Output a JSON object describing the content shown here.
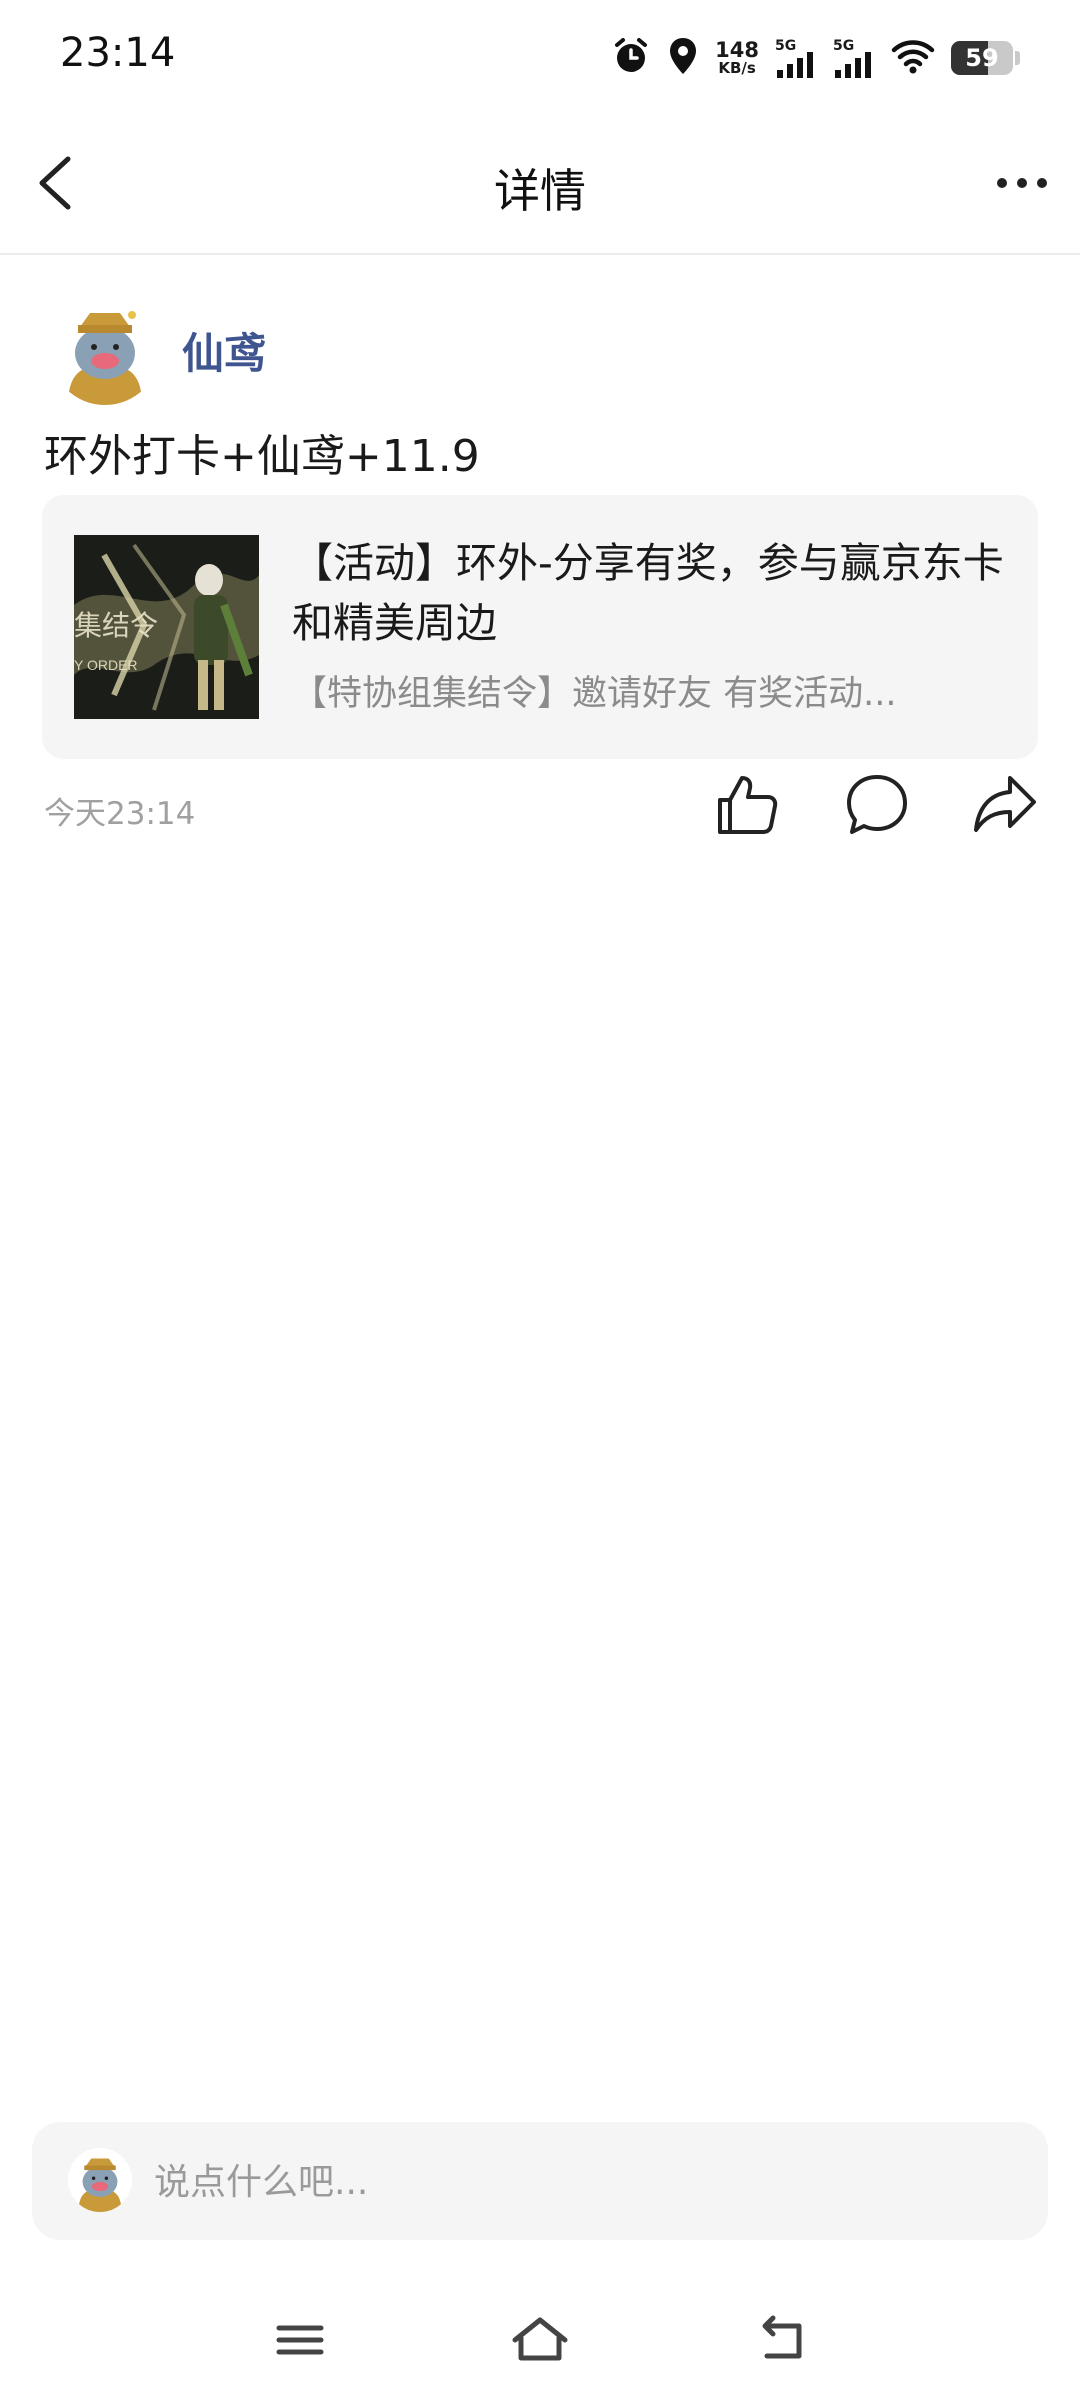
{
  "status_bar": {
    "time": "23:14",
    "net_speed_value": "148",
    "net_speed_unit": "KB/s",
    "signal1_label": "5G",
    "signal2_label": "5G",
    "battery_level": "59",
    "battery_fraction": 0.59,
    "icons": [
      "alarm-icon",
      "location-icon",
      "signal-icon",
      "signal-icon",
      "wifi-icon",
      "battery-icon"
    ]
  },
  "header": {
    "title": "详情",
    "back_icon": "chevron-left-icon",
    "more_icon": "more-horizontal-icon"
  },
  "post": {
    "author_name": "仙鸢",
    "author_name_color": "#3f5590",
    "text": "环外打卡+仙鸢+11.9",
    "share_card": {
      "title": "【活动】环外-分享有奖，参与赢京东卡和精美周边",
      "description": "【特协组集结令】邀请好友 有奖活动..."
    },
    "time": "今天23:14",
    "actions": [
      "like-icon",
      "comment-icon",
      "share-icon"
    ]
  },
  "comment_bar": {
    "placeholder": "说点什么吧..."
  },
  "system_nav": {
    "icons": [
      "menu-icon",
      "home-icon",
      "back-icon"
    ]
  }
}
